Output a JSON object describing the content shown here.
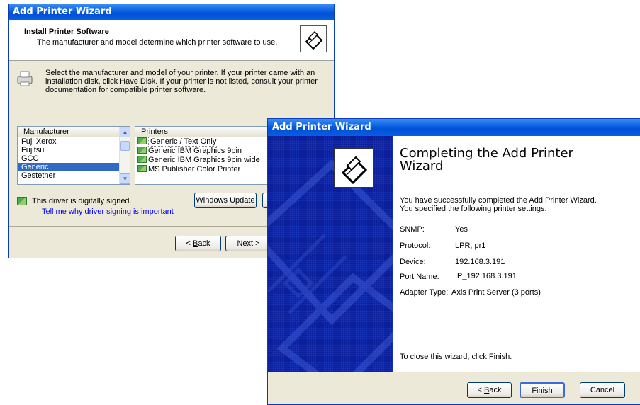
{
  "back_window": {
    "title": "Add Printer Wizard",
    "header_title": "Install Printer Software",
    "header_subtitle": "The manufacturer and model determine which printer software to use.",
    "instructions": "Select the manufacturer and model of your printer. If your printer came with an installation disk, click Have Disk. If your printer is not listed, consult your printer documentation for compatible printer software.",
    "manufacturer_header": "Manufacturer",
    "manufacturers": [
      "Fuji Xerox",
      "Fujitsu",
      "GCC",
      "Generic",
      "Gestetner"
    ],
    "selected_manufacturer_index": 3,
    "printers_header": "Printers",
    "printers": [
      "Generic / Text Only",
      "Generic IBM Graphics 9pin",
      "Generic IBM Graphics 9pin wide",
      "MS Publisher Color Printer"
    ],
    "signed_text": "This driver is digitally signed.",
    "signing_link": "Tell me why driver signing is important",
    "windows_update_button": "Windows Update",
    "back_button_label": "Back",
    "back_button_key": "B",
    "next_button_label": "Next >"
  },
  "front_window": {
    "title": "Add Printer Wizard",
    "heading": "Completing the Add Printer Wizard",
    "intro_line1": "You have successfully completed the Add Printer Wizard.",
    "intro_line2": "You specified the following printer settings:",
    "settings": [
      {
        "label": "SNMP:",
        "value": "Yes"
      },
      {
        "label": "Protocol:",
        "value": "LPR, pr1"
      },
      {
        "label": "Device:",
        "value": "192.168.3.191"
      },
      {
        "label": "Port Name:",
        "value": "IP_192.168.3.191"
      },
      {
        "label": "Adapter Type:",
        "value": "Axis Print Server (3 ports)"
      }
    ],
    "close_text": "To close this wizard, click Finish.",
    "back_button_label": "Back",
    "back_button_key": "B",
    "finish_button": "Finish",
    "cancel_button": "Cancel"
  },
  "colors": {
    "titlebar": "#0a5fe0",
    "side_panel": "#0b1f9a",
    "selection": "#316ac5",
    "link": "#0000ff"
  }
}
